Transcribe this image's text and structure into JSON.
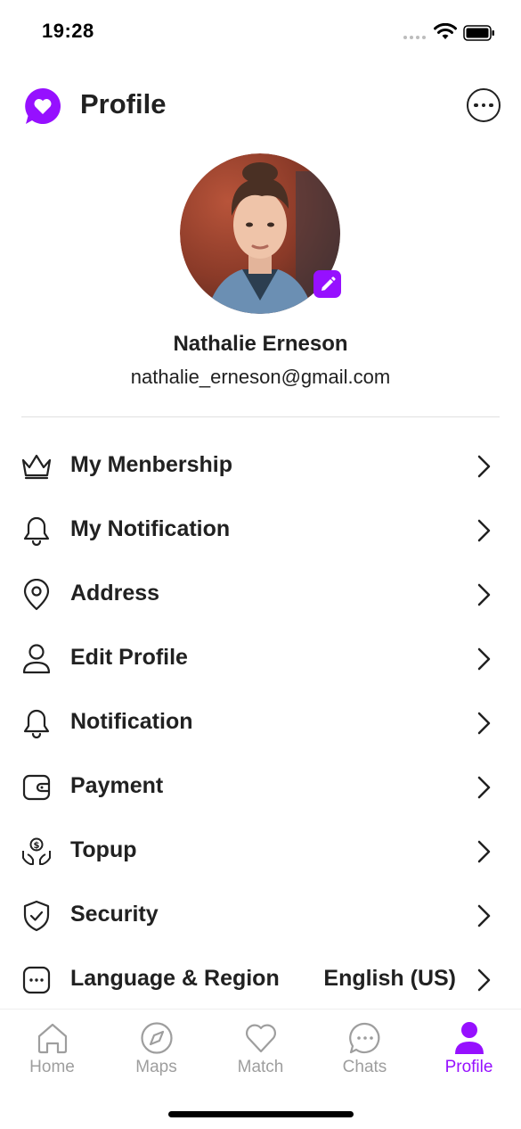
{
  "status_bar": {
    "time": "19:28"
  },
  "header": {
    "title": "Profile"
  },
  "profile": {
    "name": "Nathalie Erneson",
    "email": "nathalie_erneson@gmail.com"
  },
  "menu": [
    {
      "label": "My Menbership",
      "icon": "crown-icon"
    },
    {
      "label": "My Notification",
      "icon": "bell-icon"
    },
    {
      "label": "Address",
      "icon": "location-icon"
    },
    {
      "label": "Edit Profile",
      "icon": "user-icon"
    },
    {
      "label": "Notification",
      "icon": "bell-icon"
    },
    {
      "label": "Payment",
      "icon": "wallet-icon"
    },
    {
      "label": "Topup",
      "icon": "topup-hands-icon"
    },
    {
      "label": "Security",
      "icon": "shield-icon"
    },
    {
      "label": "Language & Region",
      "icon": "chat-dots-icon",
      "value": "English (US)"
    }
  ],
  "tabs": [
    {
      "label": "Home",
      "icon": "home-icon",
      "active": false
    },
    {
      "label": "Maps",
      "icon": "compass-icon",
      "active": false
    },
    {
      "label": "Match",
      "icon": "heart-icon",
      "active": false
    },
    {
      "label": "Chats",
      "icon": "chat-icon",
      "active": false
    },
    {
      "label": "Profile",
      "icon": "profile-icon",
      "active": true
    }
  ],
  "colors": {
    "accent": "#9610FF",
    "text": "#212121",
    "inactive": "#9E9E9E"
  }
}
